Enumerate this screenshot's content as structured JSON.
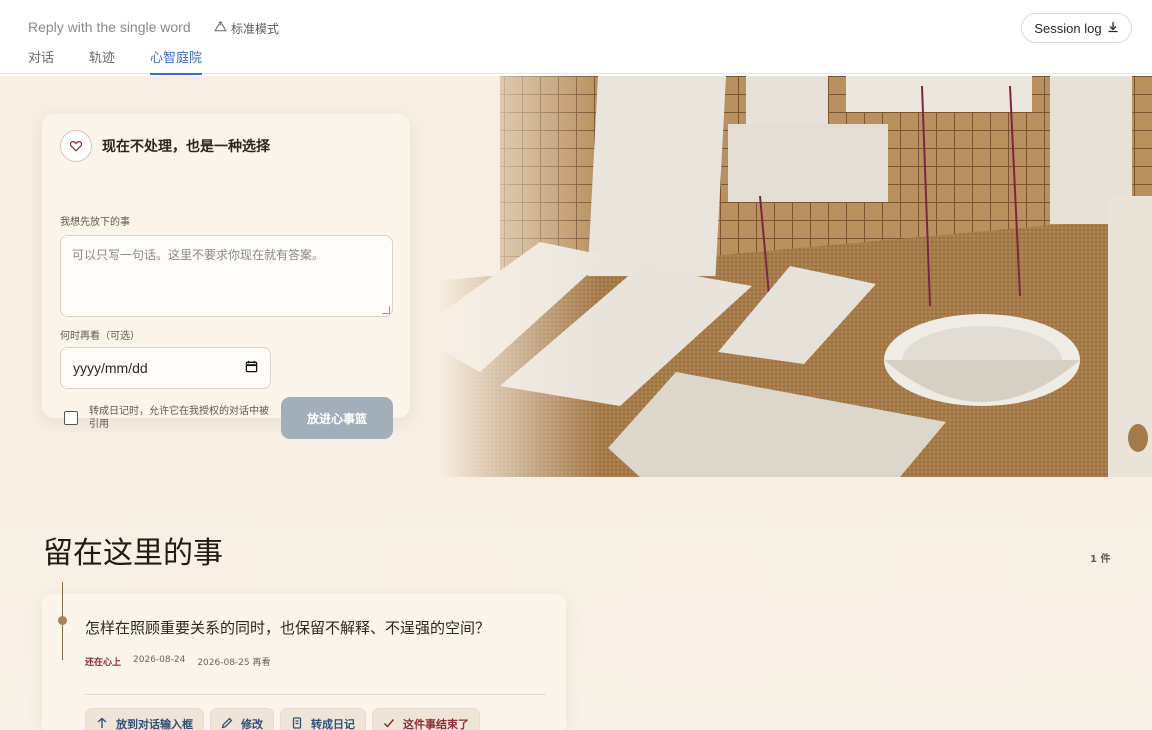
{
  "header": {
    "title": "Reply with the single word",
    "mode": "标准模式",
    "tabs": [
      "对话",
      "轨迹",
      "心智庭院"
    ],
    "active_tab": "心智庭院",
    "session_button": "Session log"
  },
  "card": {
    "title": "现在不处理，也是一种选择",
    "note_label": "我想先放下的事",
    "note_placeholder": "可以只写一句话。这里不要求你现在就有答案。",
    "date_label": "何时再看（可选）",
    "date_placeholder": "yyyy/mm/dd",
    "checkbox_label": "转成日记时，允许它在我授权的对话中被引用",
    "submit": "放进心事篮"
  },
  "section": {
    "title": "留在这里的事",
    "count": "1 件"
  },
  "item": {
    "question": "怎样在照顾重要关系的同时，也保留不解释、不逞强的空间？",
    "status": "还在心上",
    "created": "2026-08-24",
    "review": "2026-08-25 再看",
    "actions": [
      "放到对话输入框",
      "修改",
      "转成日记",
      "这件事结束了"
    ]
  },
  "colors": {
    "accent": "#3a6bc4",
    "status_red": "#8b2d36",
    "submit_disabled": "#a3aebb",
    "background_warm": "#f7efe4"
  }
}
